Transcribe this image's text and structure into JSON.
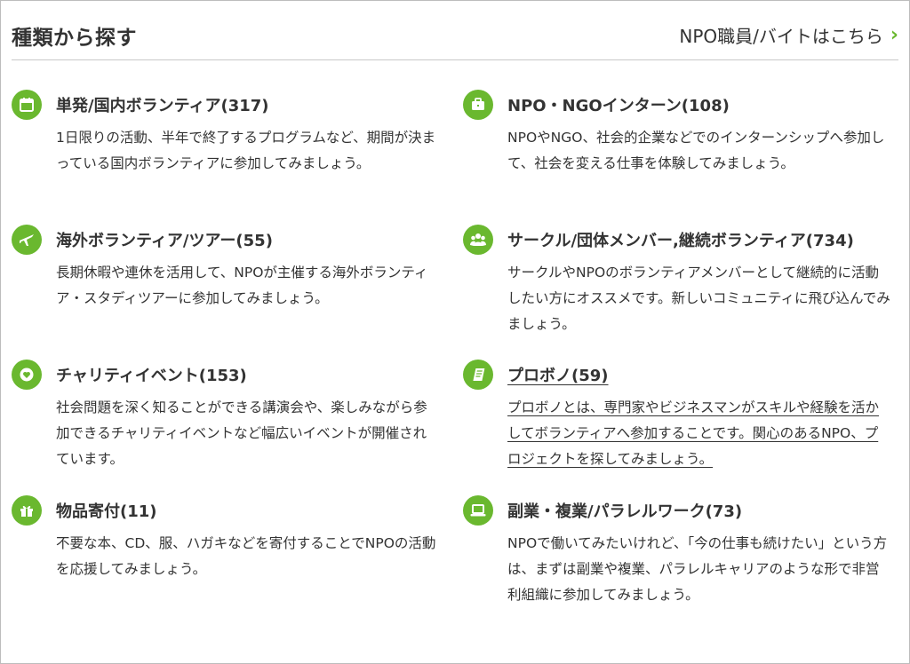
{
  "header": {
    "title": "種類から探す",
    "staff_link": "NPO職員/バイトはこちら"
  },
  "colors": {
    "accent": "#6ab82f",
    "text": "#333333",
    "border": "#c8c8c8"
  },
  "left": [
    {
      "icon": "calendar-icon",
      "title": "単発/国内ボランティア(317)",
      "desc": "1日限りの活動、半年で終了するプログラムなど、期間が決まっている国内ボランティアに参加してみましょう。"
    },
    {
      "icon": "airplane-icon",
      "title": "海外ボランティア/ツアー(55)",
      "desc": "長期休暇や連休を活用して、NPOが主催する海外ボランティア・スタディツアーに参加してみましょう。"
    },
    {
      "icon": "heart-icon",
      "title": "チャリティイベント(153)",
      "desc": "社会問題を深く知ることができる講演会や、楽しみながら参加できるチャリティイベントなど幅広いイベントが開催されています。"
    },
    {
      "icon": "gift-icon",
      "title": "物品寄付(11)",
      "desc": "不要な本、CD、服、ハガキなどを寄付することでNPOの活動を応援してみましょう。"
    }
  ],
  "right": [
    {
      "icon": "briefcase-icon",
      "title": "NPO・NGOインターン(108)",
      "desc": "NPOやNGO、社会的企業などでのインターンシップへ参加して、社会を変える仕事を体験してみましょう。"
    },
    {
      "icon": "group-icon",
      "title": "サークル/団体メンバー,継続ボランティア(734)",
      "desc": "サークルやNPOのボランティアメンバーとして継続的に活動したい方にオススメです。新しいコミュニティに飛び込んでみましょう。"
    },
    {
      "icon": "book-icon",
      "title": "プロボノ(59)",
      "desc": "プロボノとは、専門家やビジネスマンがスキルや経験を活かしてボランティアへ参加することです。関心のあるNPO、プロジェクトを探してみましょう。"
    },
    {
      "icon": "laptop-icon",
      "title": "副業・複業/パラレルワーク(73)",
      "desc": "NPOで働いてみたいけれど、「今の仕事も続けたい」という方は、まずは副業や複業、パラレルキャリアのような形で非営利組織に参加してみましょう。"
    }
  ]
}
